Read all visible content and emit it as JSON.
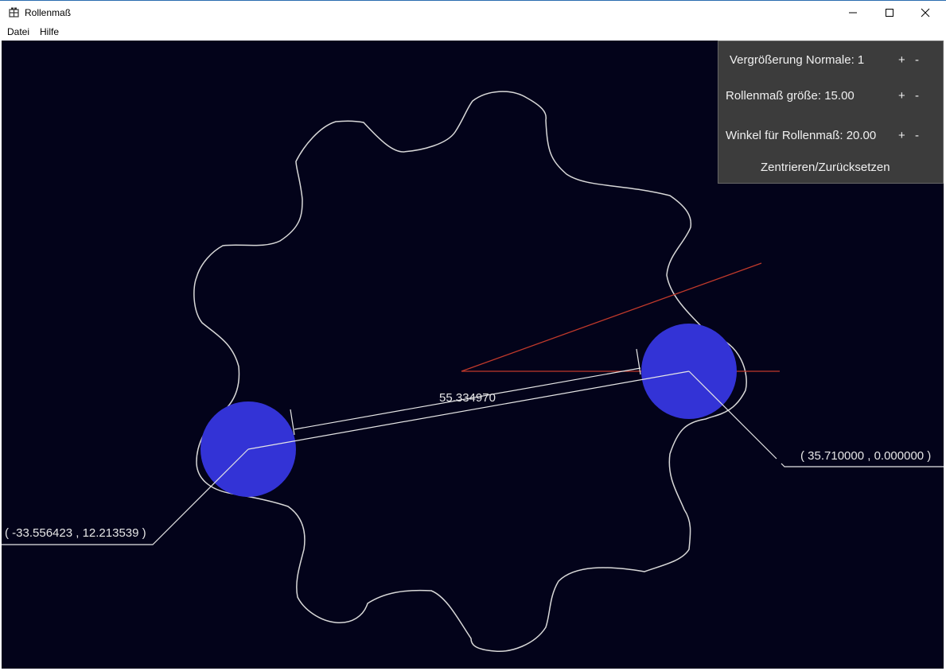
{
  "window": {
    "title": "Rollenmaß",
    "minimize_glyph": "—",
    "maximize_glyph": "☐",
    "close_glyph": "✕"
  },
  "menu": {
    "items": [
      {
        "label": "Datei"
      },
      {
        "label": "Hilfe"
      }
    ]
  },
  "panel": {
    "magnification_label": "Vergrößerung Normale: 1",
    "roller_size_label": "Rollenmaß größe: 15.00",
    "angle_label": "Winkel für Rollenmaß: 20.00",
    "plus": "+",
    "minus": "-",
    "reset_button": "Zentrieren/Zurücksetzen"
  },
  "measurement": {
    "distance_label": "55.334970",
    "left_coord_label": "( -33.556423 , 12.213539 )",
    "right_coord_label": "( 35.710000 , 0.000000 )"
  },
  "colors": {
    "canvas_bg": "#03031a",
    "gear_outline": "#d8d8d8",
    "roller_fill": "#3333d6",
    "angle_lines": "#c0392b",
    "panel_bg": "#3c3c3c"
  },
  "icons": {
    "app": "gear-app-icon"
  }
}
